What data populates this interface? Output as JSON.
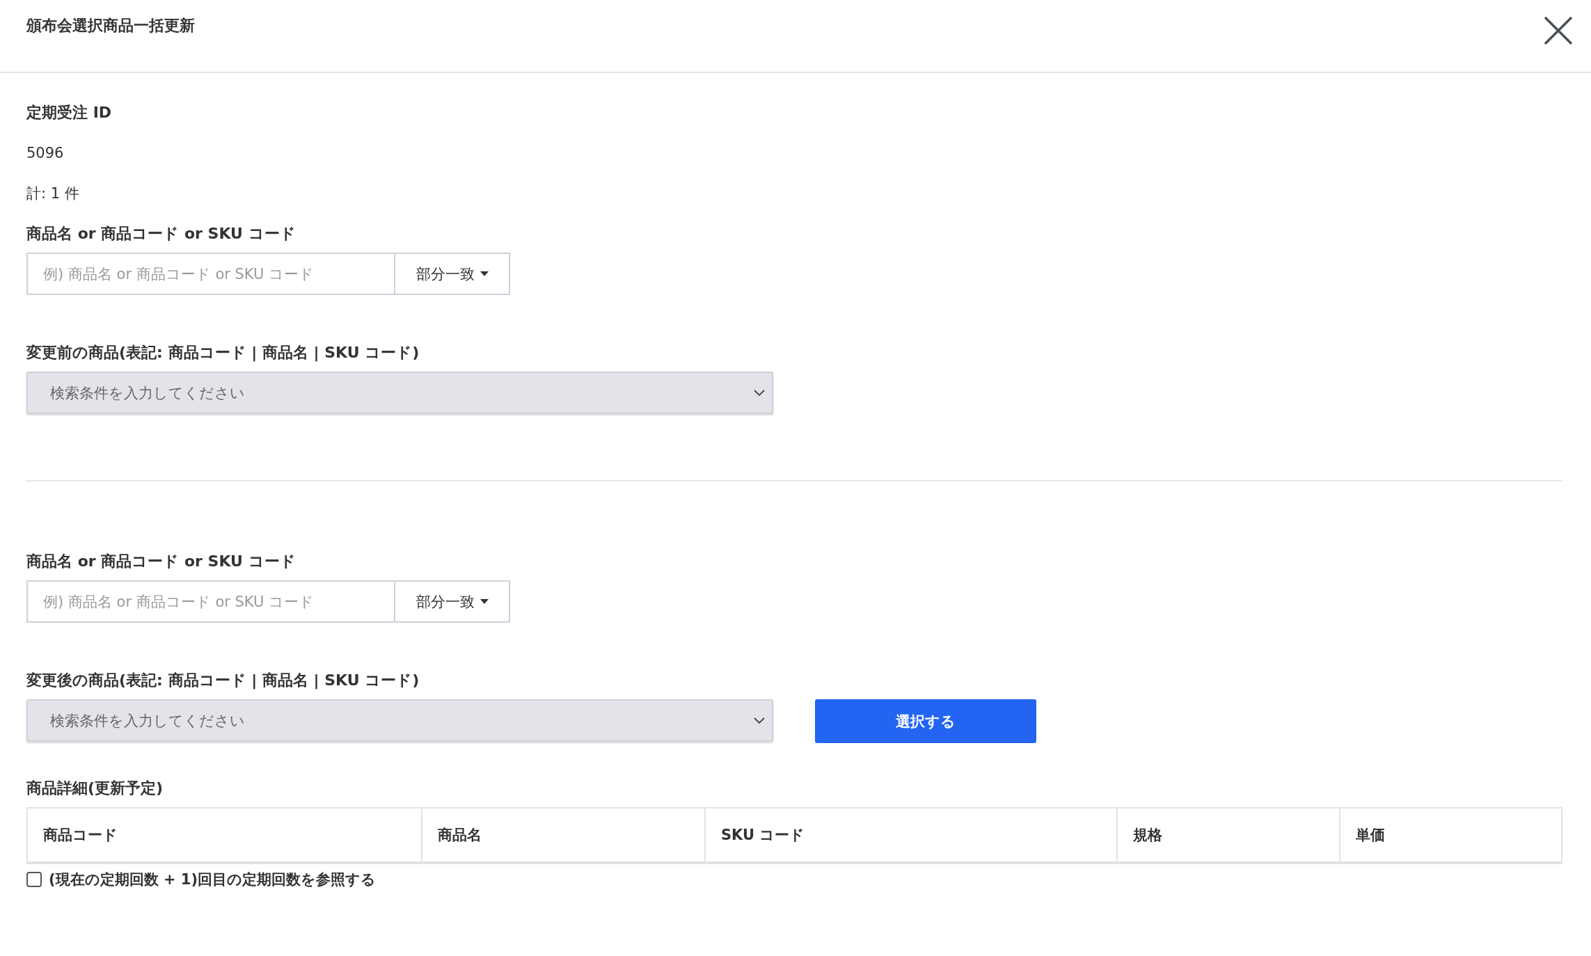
{
  "window": {
    "title": "頒布会選択商品一括更新"
  },
  "order_id": {
    "label": "定期受注 ID",
    "value": "5096"
  },
  "total": "計: 1 件",
  "sections": [
    {
      "search_label": "商品名 or 商品コード or SKU コード",
      "placeholder": "例) 商品名 or 商品コード or SKU コード",
      "match_button": "部分一致",
      "select_label": "変更前の商品(表記: 商品コード | 商品名 | SKU コード)",
      "select_placeholder": "検索条件を入力してください"
    },
    {
      "search_label": "商品名 or 商品コード or SKU コード",
      "placeholder": "例) 商品名 or 商品コード or SKU コード",
      "match_button": "部分一致",
      "select_label": "変更後の商品(表記: 商品コード | 商品名 | SKU コード)",
      "select_placeholder": "検索条件を入力してください",
      "action_button": "選択する"
    }
  ],
  "details": {
    "title": "商品詳細(更新予定)",
    "columns": [
      "商品コード",
      "商品名",
      "SKU コード",
      "規格",
      "単価"
    ]
  },
  "option": {
    "label": "(現在の定期回数 + 1)回目の定期回数を参照する",
    "checked": false
  }
}
